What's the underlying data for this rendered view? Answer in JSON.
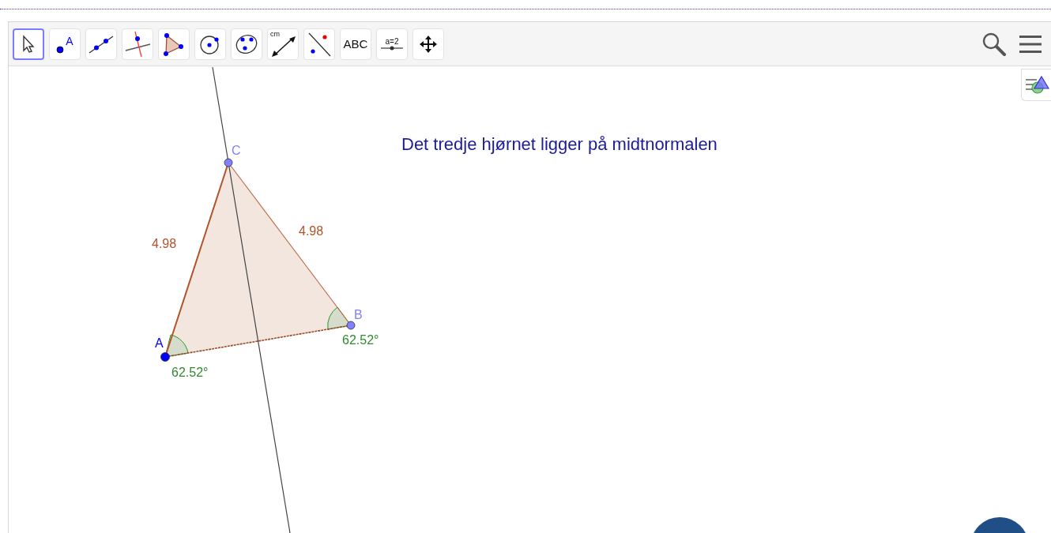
{
  "toolbar": {
    "tools": [
      {
        "kind": "move",
        "selected": true
      },
      {
        "kind": "point",
        "label": "A",
        "selected": false
      },
      {
        "kind": "line",
        "selected": false
      },
      {
        "kind": "perpendicular",
        "selected": false
      },
      {
        "kind": "polygon",
        "selected": false
      },
      {
        "kind": "circle",
        "selected": false
      },
      {
        "kind": "three-point-circle",
        "selected": false
      },
      {
        "kind": "distance",
        "label": "cm",
        "selected": false
      },
      {
        "kind": "reflect",
        "selected": false
      },
      {
        "kind": "text",
        "label": "ABC",
        "selected": false
      },
      {
        "kind": "slider",
        "label": "a=2",
        "selected": false
      },
      {
        "kind": "move-view",
        "selected": false
      }
    ]
  },
  "construction": {
    "caption": "Det tredje hjørnet ligger på midtnormalen",
    "points": [
      {
        "name": "A",
        "kind": "free"
      },
      {
        "name": "B",
        "kind": "dependent"
      },
      {
        "name": "C",
        "kind": "dependent"
      }
    ],
    "side_lengths": [
      "4.98",
      "4.98"
    ],
    "angles": [
      "62.52°",
      "62.52°"
    ]
  }
}
